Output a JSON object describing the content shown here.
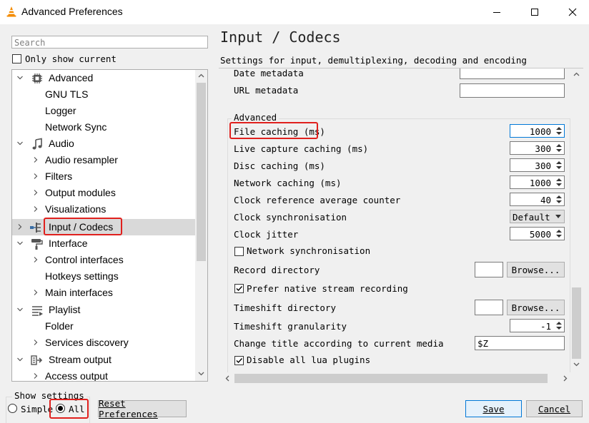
{
  "window": {
    "title": "Advanced Preferences",
    "app_icon": "vlc-cone-icon",
    "controls": [
      "minimize-icon",
      "maximize-icon",
      "close-icon"
    ]
  },
  "sidebar": {
    "search_placeholder": "Search",
    "only_show_current_label": "Only show current",
    "only_show_current_checked": false,
    "items": [
      {
        "label": "Advanced",
        "level": 0,
        "icon": "chip-icon",
        "expanded": true
      },
      {
        "label": "GNU TLS",
        "level": 1
      },
      {
        "label": "Logger",
        "level": 1
      },
      {
        "label": "Network Sync",
        "level": 1
      },
      {
        "label": "Audio",
        "level": 0,
        "icon": "music-note-icon",
        "expanded": true
      },
      {
        "label": "Audio resampler",
        "level": 1,
        "has_children": true
      },
      {
        "label": "Filters",
        "level": 1,
        "has_children": true
      },
      {
        "label": "Output modules",
        "level": 1,
        "has_children": true
      },
      {
        "label": "Visualizations",
        "level": 1,
        "has_children": true
      },
      {
        "label": "Input / Codecs",
        "level": 0,
        "icon": "codec-icon",
        "has_children": true,
        "selected": true
      },
      {
        "label": "Interface",
        "level": 0,
        "icon": "paint-roller-icon",
        "expanded": true
      },
      {
        "label": "Control interfaces",
        "level": 1,
        "has_children": true
      },
      {
        "label": "Hotkeys settings",
        "level": 1
      },
      {
        "label": "Main interfaces",
        "level": 1,
        "has_children": true
      },
      {
        "label": "Playlist",
        "level": 0,
        "icon": "list-icon",
        "expanded": true
      },
      {
        "label": "Folder",
        "level": 1
      },
      {
        "label": "Services discovery",
        "level": 1,
        "has_children": true
      },
      {
        "label": "Stream output",
        "level": 0,
        "icon": "stream-output-icon",
        "expanded": true
      },
      {
        "label": "Access output",
        "level": 1,
        "has_children": true
      }
    ]
  },
  "panel": {
    "title": "Input / Codecs",
    "subtitle": "Settings for input, demultiplexing, decoding and encoding",
    "fields_top": [
      {
        "label": "Date metadata",
        "value": ""
      },
      {
        "label": "URL metadata",
        "value": ""
      }
    ],
    "group_title": "Advanced",
    "settings": {
      "file_caching": {
        "label": "File caching (ms)",
        "value": "1000"
      },
      "live_capture_caching": {
        "label": "Live capture caching (ms)",
        "value": "300"
      },
      "disc_caching": {
        "label": "Disc caching (ms)",
        "value": "300"
      },
      "network_caching": {
        "label": "Network caching (ms)",
        "value": "1000"
      },
      "clock_ref_avg": {
        "label": "Clock reference average counter",
        "value": "40"
      },
      "clock_sync": {
        "label": "Clock synchronisation",
        "value": "Default"
      },
      "clock_jitter": {
        "label": "Clock jitter",
        "value": "5000"
      },
      "network_sync": {
        "label": "Network synchronisation",
        "checked": false
      },
      "record_directory": {
        "label": "Record directory",
        "value": "",
        "button": "Browse..."
      },
      "prefer_native_recording": {
        "label": "Prefer native stream recording",
        "checked": true
      },
      "timeshift_directory": {
        "label": "Timeshift directory",
        "value": "",
        "button": "Browse..."
      },
      "timeshift_granularity": {
        "label": "Timeshift granularity",
        "value": "-1"
      },
      "change_title": {
        "label": "Change title according to current media",
        "value": "$Z"
      },
      "disable_lua": {
        "label": "Disable all lua plugins",
        "checked": true
      }
    }
  },
  "footer": {
    "show_settings_label": "Show settings",
    "simple_label": "Simple",
    "all_label": "All",
    "selected_mode": "All",
    "reset_label": "Reset Preferences",
    "save_label": "Save",
    "cancel_label": "Cancel"
  },
  "colors": {
    "highlight": "#e0201d",
    "accent": "#0078d7",
    "selected_row": "#d9d9d9"
  }
}
